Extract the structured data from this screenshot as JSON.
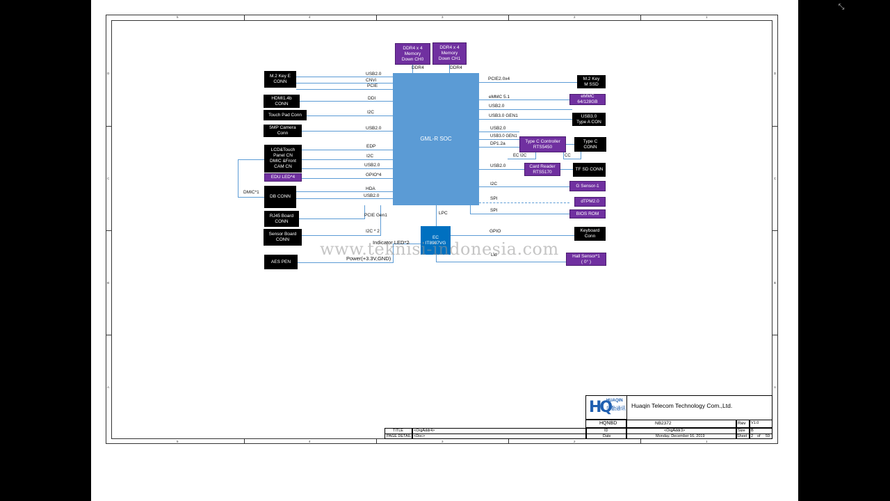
{
  "viewer": {
    "exit_fullscreen_icon": "exit-fullscreen-icon"
  },
  "frame": {
    "zones_top": [
      "5",
      "4",
      "3",
      "2",
      "1"
    ],
    "zones_left": [
      "D",
      "C",
      "B",
      "A"
    ]
  },
  "soc": {
    "label": "GML-R  SOC"
  },
  "blocks": {
    "ddr4_ch0": "DDR4 x 4\nMemory\nDown CH0",
    "ddr4_ch1": "DDR4 x 4\nMemory\nDown CH1",
    "m2_key_e": "M.2 Key E\nCONN",
    "hdmi": "HDMI1.4b\nCONN",
    "touch_pad": "Touch Pad  Conn",
    "camera": "5MP Camera\nConn",
    "lcd_panel": "LCD&Touch\nPanel CN\nDMIC &Front\nCAM CN",
    "edu_led": "EDU LED*4",
    "db_conn": "DB CONN",
    "rj45": "RJ45 Board\nCONN",
    "sensor_board": "Sensor Board\nCONN",
    "aes_pen": "AES PEN",
    "m2_ssd": "M.2 Key\nM SSD",
    "emmc": "eMMC\n64/128GB",
    "usb3_type_a": "USB3.0\nType A CON",
    "type_c_ctrl": "Type C  Controller\nRTS5450",
    "type_c_conn": "Type C\nCONN",
    "card_reader": "Card Reader\nRTS5170",
    "tf_sd": "TF SD CONN",
    "g_sensor": "G Sensor-1",
    "dtpm": "dTPM2.0",
    "bios_rom": "BIOS ROM",
    "ec": "EC\nIT8987VG",
    "keyboard": "Keyboard\nConn",
    "hall_sensor": "Hall Sensor*1\n( 0° )"
  },
  "labels": {
    "ddr4_a": "DDR4",
    "ddr4_b": "DDR4",
    "usb20_m2": "USB2.0",
    "cnvi": "CNVi",
    "pcie": "PCIE",
    "ddi": "DDI",
    "i2c_tp": "I2C",
    "usb20_cam": "USB2.0",
    "edp": "EDP",
    "i2c_lcd": "I2C",
    "usb20_lcd": "USB2.0",
    "gpio4": "GPIO*4",
    "dmic1": "DMIC*1",
    "hda": "HDA",
    "usb20_db": "USB2.0",
    "pcie_gen1": "PCIE Gen1",
    "i2c2": "I2C * 2",
    "indicator_led": "Indicator LED*2",
    "power": "Power(+3.3V,GND)",
    "pcie_x4": "PCIE2.0x4",
    "emmc51": "eMMC 5.1",
    "usb20_r1": "USB2.0",
    "usb30_gen1_a": "USB3.0 GEN1",
    "usb20_r2": "USB2.0",
    "usb30_gen1_b": "USB3.0 GEN1",
    "dp12a": "DP1.2a",
    "ec_i2c": "EC I2C",
    "cc": "CC",
    "usb20_card": "USB2.0",
    "i2c_g": "I2C",
    "spi_tpm": "SPI",
    "spi_bios": "SPI",
    "lpc": "LPC",
    "gpio_kb": "GPIO",
    "lid": "Lid"
  },
  "watermark": "www.teknisi-indonesia.com",
  "title_block": {
    "company": "Huaqin Telecom Technology Com.,Ltd.",
    "logo_text": "HUAQIN",
    "logo_cn": "华勤通讯",
    "project": "HQNBD",
    "board": "NB2372",
    "rev_label": "Rev",
    "rev": "V1.0",
    "title_label": "TITLE",
    "title_value": "<OrgAddr4>",
    "page_detail_label": "PAGE  DETAIL",
    "page_detail_value": "<Doc>",
    "id_label": "ID",
    "id_value": "<OrgAddr3>",
    "date_label": "Date",
    "date_value": "Monday, December 16, 2019",
    "size_label": "Size",
    "size_value": "B",
    "sheet_label": "Sheet",
    "sheet_num": "2",
    "sheet_of": "of",
    "sheet_total": "59"
  },
  "colors": {
    "soc": "#5b9bd5",
    "purple": "#7030a0",
    "ec": "#0070c0",
    "line": "#5b9bd5"
  }
}
